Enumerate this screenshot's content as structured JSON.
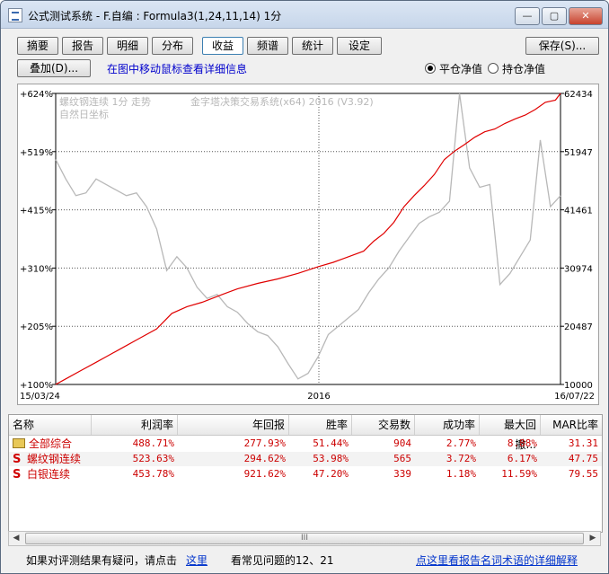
{
  "window": {
    "title": "公式测试系统 - F.自编 : Formula3(1,24,11,14) 1分",
    "minimize_label": "—",
    "maximize_label": "▢",
    "close_label": "✕"
  },
  "toolbar": {
    "tabs": [
      "摘要",
      "报告",
      "明细",
      "分布",
      "收益",
      "频谱",
      "统计",
      "设定"
    ],
    "active_tab": "收益",
    "save_label": "保存(S)...",
    "overlay_label": "叠加(D)...",
    "hint": "在图中移动鼠标查看详细信息",
    "radio_flat": "平仓净值",
    "radio_hold": "持仓净值"
  },
  "chart_data": {
    "type": "line",
    "title": "",
    "legend_left": "螺纹钢连续 1分 走势",
    "legend_left2": "自然日坐标",
    "legend_right": "金字塔决策交易系统(x64) 2016 (V3.92)",
    "x_start_label": "15/03/24",
    "x_mid_label": "2016",
    "x_end_label": "16/07/22",
    "y_left_ticks": [
      "+624%",
      "+519%",
      "+415%",
      "+310%",
      "+205%",
      "+100%"
    ],
    "y_right_ticks": [
      "62434",
      "51947",
      "41461",
      "30974",
      "20487",
      "10000"
    ],
    "ylim_left": [
      100,
      624
    ],
    "ylim_right": [
      10000,
      62434
    ],
    "series": [
      {
        "role": "equity",
        "color": "#e00000",
        "x": [
          0,
          0.02,
          0.05,
          0.08,
          0.1,
          0.13,
          0.16,
          0.2,
          0.23,
          0.26,
          0.29,
          0.33,
          0.36,
          0.4,
          0.44,
          0.48,
          0.52,
          0.55,
          0.58,
          0.61,
          0.63,
          0.65,
          0.67,
          0.69,
          0.71,
          0.73,
          0.75,
          0.77,
          0.79,
          0.81,
          0.83,
          0.85,
          0.87,
          0.89,
          0.91,
          0.93,
          0.95,
          0.97,
          0.99,
          1.0
        ],
        "y": [
          100,
          110,
          125,
          140,
          150,
          165,
          180,
          200,
          228,
          240,
          248,
          262,
          272,
          282,
          290,
          300,
          312,
          320,
          330,
          340,
          358,
          372,
          392,
          420,
          440,
          458,
          478,
          505,
          520,
          532,
          545,
          555,
          560,
          570,
          578,
          585,
          595,
          608,
          612,
          624
        ]
      },
      {
        "role": "price",
        "color": "#b8b8b8",
        "x": [
          0,
          0.02,
          0.04,
          0.06,
          0.08,
          0.1,
          0.12,
          0.14,
          0.16,
          0.18,
          0.2,
          0.22,
          0.24,
          0.26,
          0.28,
          0.3,
          0.32,
          0.34,
          0.36,
          0.38,
          0.4,
          0.42,
          0.44,
          0.46,
          0.48,
          0.5,
          0.52,
          0.54,
          0.56,
          0.58,
          0.6,
          0.62,
          0.64,
          0.66,
          0.68,
          0.7,
          0.72,
          0.74,
          0.76,
          0.78,
          0.8,
          0.82,
          0.84,
          0.86,
          0.88,
          0.9,
          0.92,
          0.94,
          0.96,
          0.98,
          1.0
        ],
        "y": [
          505,
          470,
          440,
          445,
          470,
          460,
          450,
          440,
          445,
          420,
          380,
          305,
          330,
          310,
          275,
          255,
          262,
          240,
          230,
          210,
          195,
          188,
          168,
          138,
          110,
          120,
          150,
          190,
          205,
          220,
          235,
          265,
          290,
          310,
          340,
          365,
          390,
          402,
          410,
          430,
          624,
          490,
          455,
          460,
          280,
          300,
          330,
          360,
          540,
          420,
          440
        ]
      }
    ]
  },
  "table": {
    "headers": [
      "名称",
      "利润率",
      "年回报",
      "胜率",
      "交易数",
      "成功率",
      "最大回撤...",
      "MAR比率"
    ],
    "rows": [
      {
        "icon": "folder-icon",
        "name": "全部综合",
        "profit": "488.71%",
        "annual": "277.93%",
        "win": "51.44%",
        "trades": "904",
        "success": "2.77%",
        "drawdown": "8.88%",
        "mar": "31.31"
      },
      {
        "icon": "s-icon",
        "icon_label": "S",
        "name": "螺纹钢连续",
        "profit": "523.63%",
        "annual": "294.62%",
        "win": "53.98%",
        "trades": "565",
        "success": "3.72%",
        "drawdown": "6.17%",
        "mar": "47.75"
      },
      {
        "icon": "s-icon",
        "icon_label": "S",
        "name": "白银连续",
        "profit": "453.78%",
        "annual": "921.62%",
        "win": "47.20%",
        "trades": "339",
        "success": "1.18%",
        "drawdown": "11.59%",
        "mar": "79.55"
      }
    ],
    "scroll_thumb": "III"
  },
  "status": {
    "question": "如果对评测结果有疑问，请点击",
    "here_link": "这里",
    "common": "看常见问题的12、21",
    "glossary_link": "点这里看报告名词术语的详细解释"
  },
  "colors": {
    "equity": "#e00000",
    "price": "#b8b8b8",
    "red_text": "#cc0000"
  }
}
